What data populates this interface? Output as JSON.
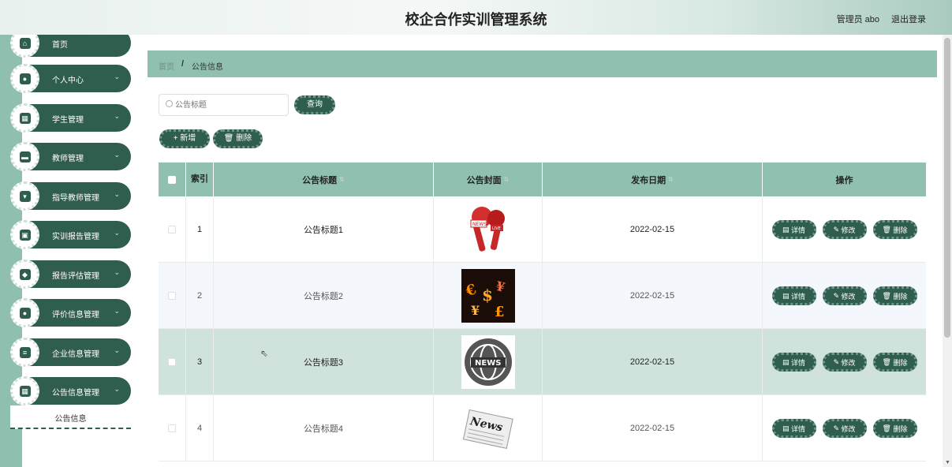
{
  "header": {
    "title": "校企合作实训管理系统",
    "user": "管理员 abo",
    "logout": "退出登录"
  },
  "sidebar": {
    "items": [
      {
        "label": "首页",
        "icon": "home-icon",
        "glyph": "⌂",
        "chevron": ""
      },
      {
        "label": "个人中心",
        "icon": "user-icon",
        "glyph": "●",
        "chevron": "⌄"
      },
      {
        "label": "学生管理",
        "icon": "grid-icon",
        "glyph": "▦",
        "chevron": "⌄"
      },
      {
        "label": "教师管理",
        "icon": "briefcase-icon",
        "glyph": "▬",
        "chevron": "⌄"
      },
      {
        "label": "指导教师管理",
        "icon": "cup-icon",
        "glyph": "▾",
        "chevron": "⌄"
      },
      {
        "label": "实训报告管理",
        "icon": "report-icon",
        "glyph": "▣",
        "chevron": "⌄"
      },
      {
        "label": "报告评估管理",
        "icon": "location-icon",
        "glyph": "◆",
        "chevron": "⌄"
      },
      {
        "label": "评价信息管理",
        "icon": "person-icon",
        "glyph": "●",
        "chevron": "⌄"
      },
      {
        "label": "企业信息管理",
        "icon": "sliders-icon",
        "glyph": "≡",
        "chevron": "⌄"
      },
      {
        "label": "公告信息管理",
        "icon": "grid-icon",
        "glyph": "▦",
        "chevron": "⌄"
      }
    ],
    "sub_item": "公告信息"
  },
  "breadcrumb": {
    "home": "首页",
    "separator": "/",
    "current": "公告信息"
  },
  "search": {
    "placeholder": "公告标题",
    "button": "查询"
  },
  "toolbar": {
    "add": "+ 新增",
    "delete": "🗑 删除"
  },
  "table": {
    "headers": [
      "",
      "索引",
      "公告标题",
      "公告封面",
      "发布日期",
      "操作"
    ],
    "rows": [
      {
        "index": "1",
        "title": "公告标题1",
        "date": "2022-02-15",
        "cover": "microphone-news"
      },
      {
        "index": "2",
        "title": "公告标题2",
        "date": "2022-02-15",
        "cover": "money-symbols"
      },
      {
        "index": "3",
        "title": "公告标题3",
        "date": "2022-02-15",
        "cover": "news-globe"
      },
      {
        "index": "4",
        "title": "公告标题4",
        "date": "2022-02-15",
        "cover": "newspaper"
      }
    ],
    "actions": {
      "detail": "详情",
      "edit": "修改",
      "delete": "删除"
    }
  },
  "colors": {
    "accent": "#2f5e4e",
    "header_row": "#90c0b0",
    "sidebar_strip": "#8fbfaf"
  }
}
